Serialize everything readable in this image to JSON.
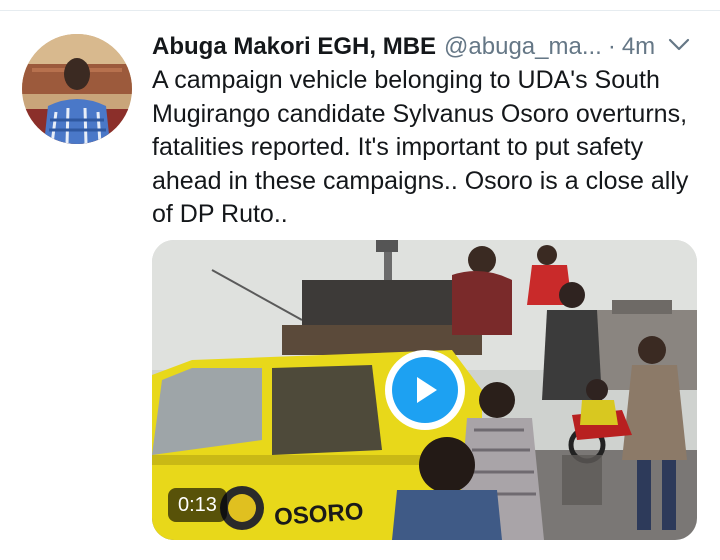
{
  "tweet": {
    "author": {
      "display_name": "Abuga Makori EGH, MBE",
      "handle": "@abuga_ma...",
      "avatar_alt": "profile-photo"
    },
    "separator": "·",
    "timestamp": "4m",
    "text": "A campaign vehicle belonging to UDA's South\nMugirango candidate Sylvanus Osoro overturns,\nfatalities reported. It's important to put safety\nahead in these campaigns.. Osoro is a close ally\nof DP Ruto..",
    "media": {
      "type": "video",
      "duration": "0:13",
      "vehicle_text": "OSORO",
      "icons": [
        "play-icon"
      ]
    }
  },
  "icons": [
    "chevron-down-icon",
    "play-icon"
  ],
  "colors": {
    "accent": "#1da1f2",
    "secondary_text": "#657786",
    "primary_text": "#14171a"
  }
}
